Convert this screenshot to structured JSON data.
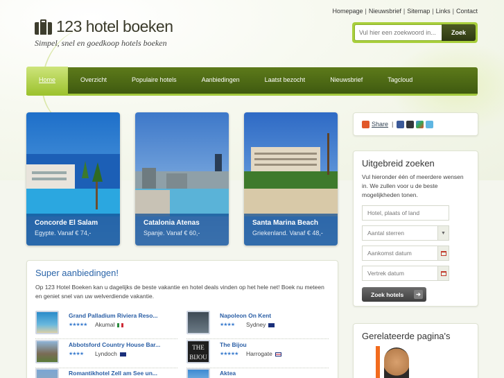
{
  "top_links": [
    "Homepage",
    "Nieuwsbrief",
    "Sitemap",
    "Links",
    "Contact"
  ],
  "logo": {
    "title": "123 hotel boeken",
    "tagline": "Simpel, snel en goedkoop hotels boeken"
  },
  "search": {
    "placeholder": "Vul hier een zoekwoord in...",
    "button": "Zoek"
  },
  "nav": [
    {
      "label": "Home",
      "active": true
    },
    {
      "label": "Overzicht"
    },
    {
      "label": "Populaire hotels"
    },
    {
      "label": "Aanbiedingen"
    },
    {
      "label": "Laatst bezocht"
    },
    {
      "label": "Nieuwsbrief"
    },
    {
      "label": "Tagcloud"
    }
  ],
  "featured": [
    {
      "name": "Concorde El Salam",
      "sub": "Egypte. Vanaf € 74,-"
    },
    {
      "name": "Catalonia Atenas",
      "sub": "Spanje. Vanaf € 60,-"
    },
    {
      "name": "Santa Marina Beach",
      "sub": "Griekenland. Vanaf € 48,-"
    }
  ],
  "share": {
    "label": "Share",
    "separator": "|",
    "icons": [
      "share-plus-icon",
      "facebook-icon",
      "myspace-icon",
      "google-icon",
      "twitter-icon"
    ]
  },
  "advanced_search": {
    "title": "Uitgebreid zoeken",
    "description": "Vul hieronder één of meerdere wensen in. We zullen voor u de beste mogelijkheden tonen.",
    "place_placeholder": "Hotel, plaats of land",
    "stars_placeholder": "Aantal sterren",
    "arrival_placeholder": "Aankomst datum",
    "departure_placeholder": "Vertrek datum",
    "button": "Zoek hotels"
  },
  "related": {
    "title": "Gerelateerde pagina's"
  },
  "deals": {
    "title": "Super aanbiedingen!",
    "intro": "Op 123 Hotel Boeken kan u dagelijks de beste vakantie en hotel deals vinden op het hele net! Boek nu meteen en geniet snel van uw welverdiende vakantie.",
    "items": [
      {
        "name": "Grand Palladium Riviera Reso...",
        "stars": "★★★★★",
        "rating": 5,
        "location": "Akumal",
        "flag": "mexico-flag-icon"
      },
      {
        "name": "Napoleon On Kent",
        "stars": "★★★★",
        "rating": 4,
        "location": "Sydney",
        "flag": "australia-flag-icon"
      },
      {
        "name": "Abbotsford Country House Bar...",
        "stars": "★★★★",
        "rating": 4,
        "location": "Lyndoch",
        "flag": "australia-flag-icon"
      },
      {
        "name": "The Bijou",
        "stars": "★★★★★",
        "rating": 5,
        "location": "Harrogate",
        "flag": "uk-flag-icon"
      },
      {
        "name": "Romantikhotel Zell am See un...",
        "stars": "",
        "rating": null,
        "location": "",
        "flag": ""
      },
      {
        "name": "Aktea",
        "stars": "",
        "rating": null,
        "location": "",
        "flag": ""
      }
    ]
  },
  "colors": {
    "accent_green": "#a9cf3c",
    "nav_green": "#4d6a15",
    "link_blue": "#2a64a8",
    "card_caption": "#14508f"
  }
}
